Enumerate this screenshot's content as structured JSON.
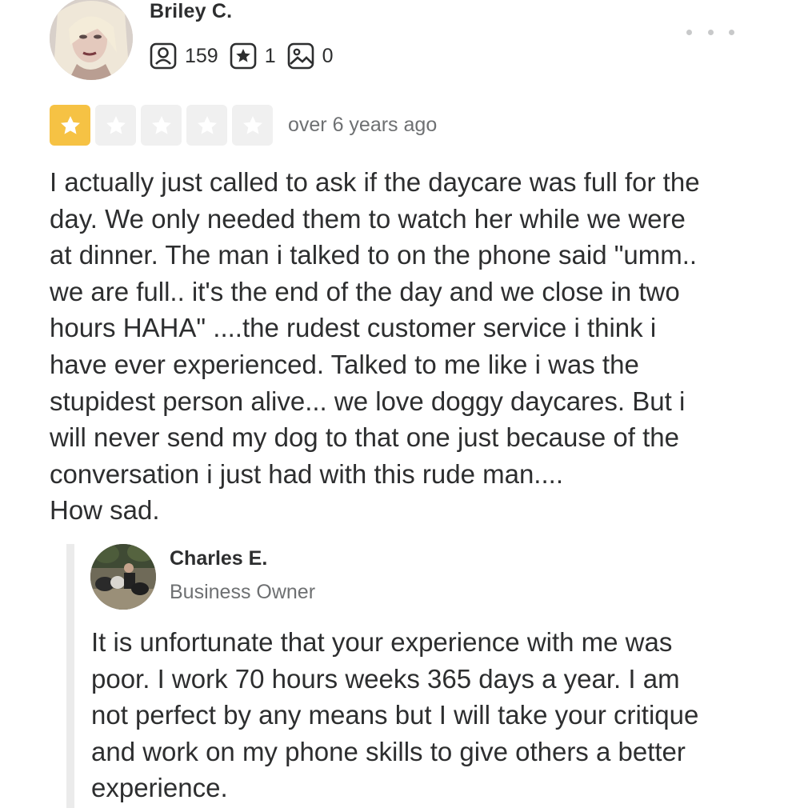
{
  "review": {
    "reviewer": {
      "name": "Briley C.",
      "avatar_icon": "user-avatar-photo",
      "stats": [
        {
          "icon": "friends-icon",
          "value": "159"
        },
        {
          "icon": "reviews-star-icon",
          "value": "1"
        },
        {
          "icon": "photos-icon",
          "value": "0"
        }
      ]
    },
    "more_menu_icon": "more-options-icon",
    "rating": {
      "value": 1,
      "max": 5,
      "filled_color": "#f6c244",
      "empty_color": "#f0f0f0"
    },
    "date": "over 6 years ago",
    "text_lines": [
      "I actually just called to ask if the daycare was full for the",
      "day. We only needed them to watch her while we were",
      "at dinner. The man i talked to on the phone said \"umm..",
      "we are full.. it's the end of the day and we close in two",
      "hours HAHA\" ....the rudest customer service i think i",
      "have ever experienced. Talked to me like i was the",
      "stupidest person alive... we love doggy daycares. But i",
      "will never send my dog to that one just because of the",
      "conversation i just had with this rude man....",
      "How sad."
    ]
  },
  "owner_reply": {
    "name": "Charles E.",
    "role": "Business Owner",
    "avatar_icon": "owner-avatar-photo",
    "text_lines": [
      "It is unfortunate that your experience with me was",
      "poor. I work 70 hours weeks 365 days a year. I am",
      "not perfect by any means but I will take your critique",
      "and work on my phone skills to give others a better",
      "experience."
    ]
  }
}
